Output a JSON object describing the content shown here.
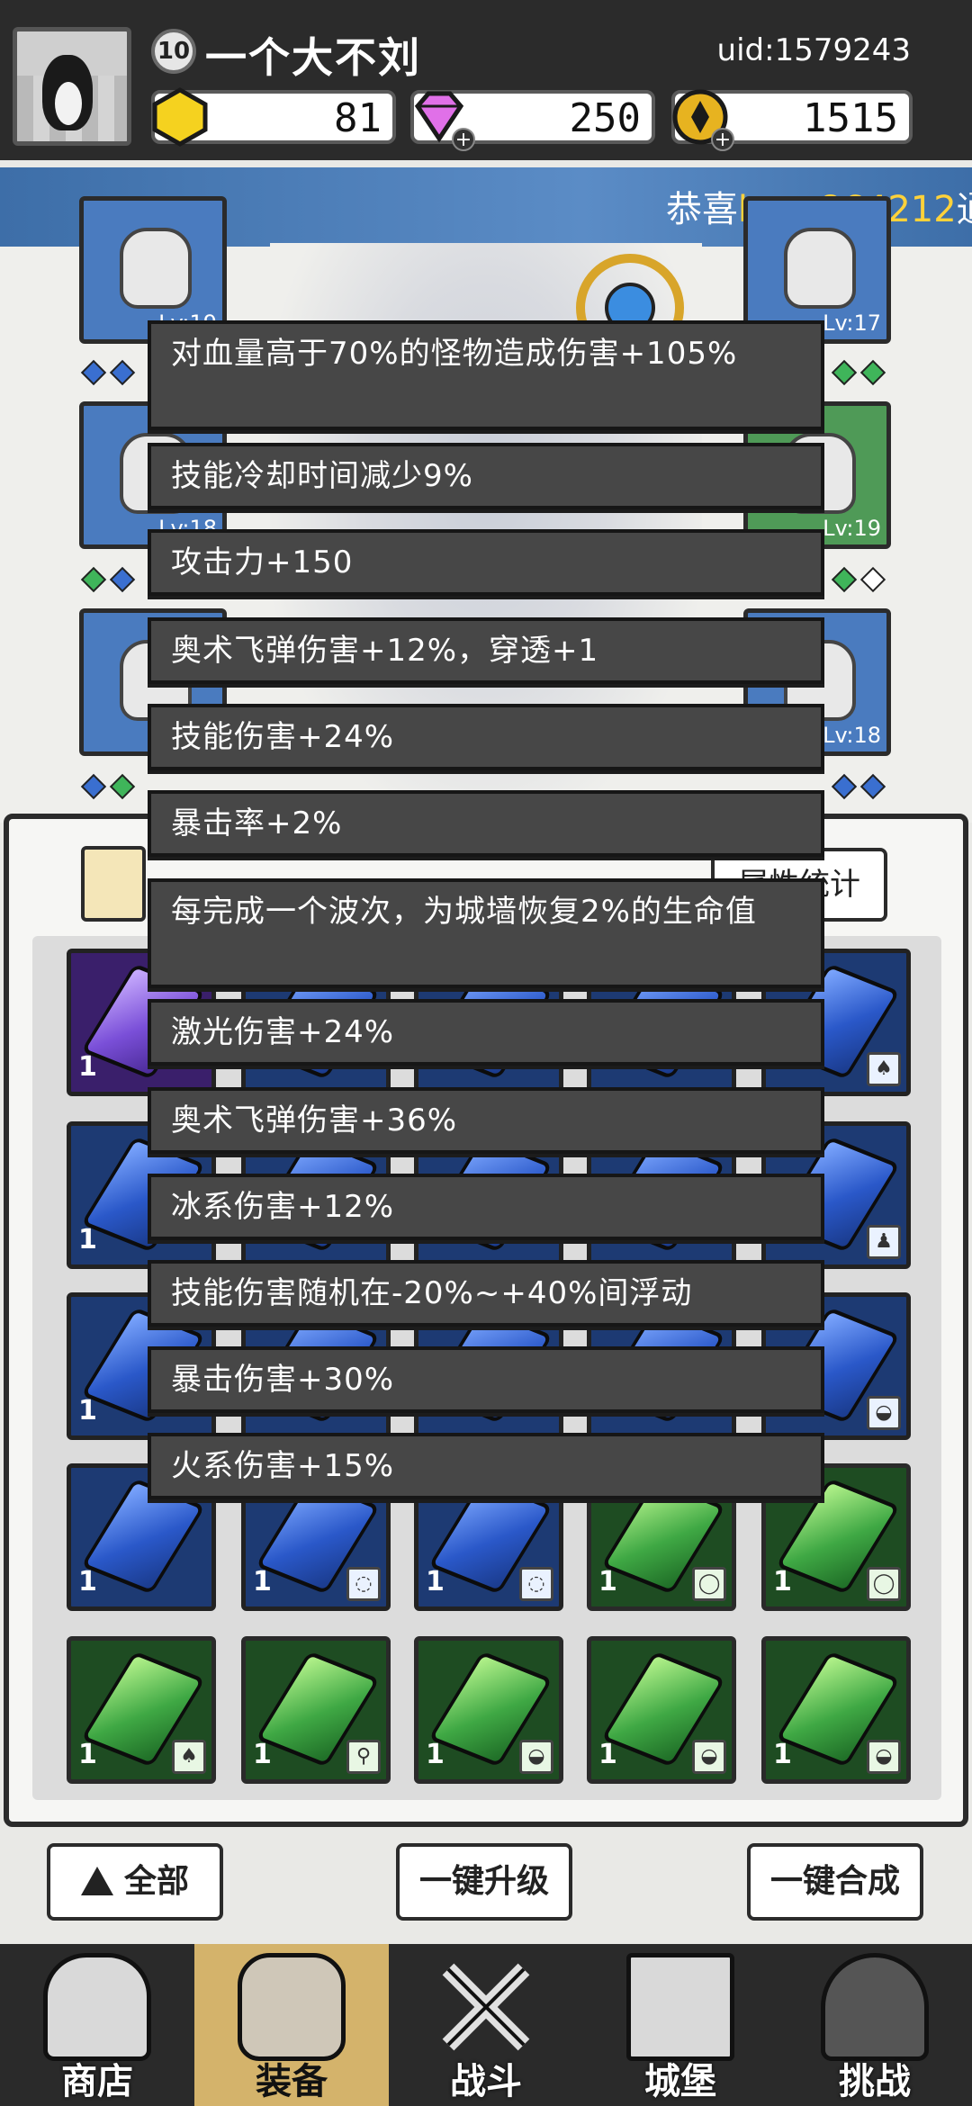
{
  "player": {
    "level": "10",
    "name": "一个大不刘",
    "uid": "uid:1579243"
  },
  "resources": {
    "gold_hex": "81",
    "diamond": "250",
    "coin": "1515"
  },
  "banner": {
    "prefix": "恭喜",
    "highlight": "hero864212",
    "suffix": "通"
  },
  "equipment": {
    "slots": [
      {
        "lv": "Lv:19"
      },
      {
        "lv": "Lv:17"
      },
      {
        "lv": "Lv:18"
      },
      {
        "lv": "Lv:19"
      },
      {
        "lv": "Lv:18"
      }
    ]
  },
  "bag": {
    "stat_button": "属性统计"
  },
  "tooltip": {
    "lines": [
      "对血量高于70%的怪物造成伤害+105%",
      "技能冷却时间减少9%",
      "攻击力+150",
      "奥术飞弹伤害+12%，穿透+1",
      "技能伤害+24%",
      "暴击率+2%",
      "每完成一个波次，为城墙恢复2%的生命值",
      "激光伤害+24%",
      "奥术飞弹伤害+36%",
      "冰系伤害+12%",
      "技能伤害随机在-20%~+40%间浮动",
      "暴击伤害+30%",
      "火系伤害+15%"
    ]
  },
  "grid": {
    "count": "1"
  },
  "actions": {
    "all": "全部",
    "upgrade": "一键升级",
    "merge": "一键合成"
  },
  "nav": {
    "shop": "商店",
    "equip": "装备",
    "battle": "战斗",
    "castle": "城堡",
    "challenge": "挑战"
  },
  "colors": {
    "accent_yellow": "#ffd23a",
    "tooltip_bg": "#474747",
    "nav_active": "#d4b36b"
  }
}
